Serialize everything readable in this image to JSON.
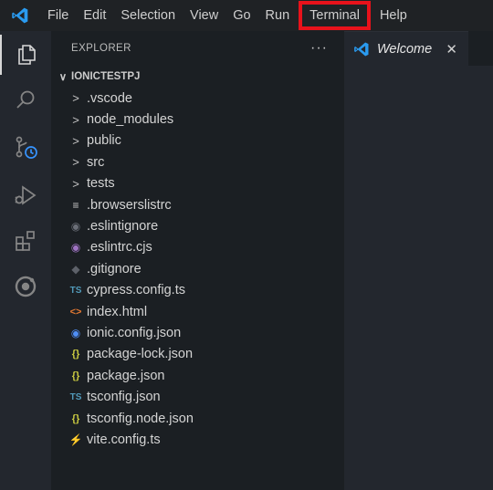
{
  "menubar": {
    "items": [
      "File",
      "Edit",
      "Selection",
      "View",
      "Go",
      "Run",
      "Terminal",
      "Help"
    ],
    "highlighted": "Terminal",
    "highlight_color": "#e8121b",
    "logo_icon": "vscode-logo-icon"
  },
  "activitybar": {
    "items": [
      {
        "icon": "files-icon",
        "active": true
      },
      {
        "icon": "search-icon",
        "active": false
      },
      {
        "icon": "source-control-icon",
        "active": false
      },
      {
        "icon": "run-debug-icon",
        "active": false
      },
      {
        "icon": "extensions-icon",
        "active": false
      },
      {
        "icon": "ionic-icon",
        "active": false
      }
    ]
  },
  "explorer": {
    "title": "EXPLORER",
    "more": "···",
    "folder_chevron": "∨",
    "folder": "IONICTESTPJ",
    "entries": [
      {
        "name": ".vscode",
        "type": "folder",
        "icon": "chevron-right-icon",
        "glyph": ">",
        "color": "#c5c5c5"
      },
      {
        "name": "node_modules",
        "type": "folder",
        "icon": "chevron-right-icon",
        "glyph": ">",
        "color": "#c5c5c5"
      },
      {
        "name": "public",
        "type": "folder",
        "icon": "chevron-right-icon",
        "glyph": ">",
        "color": "#c5c5c5"
      },
      {
        "name": "src",
        "type": "folder",
        "icon": "chevron-right-icon",
        "glyph": ">",
        "color": "#c5c5c5"
      },
      {
        "name": "tests",
        "type": "folder",
        "icon": "chevron-right-icon",
        "glyph": ">",
        "color": "#c5c5c5"
      },
      {
        "name": ".browserslistrc",
        "type": "file",
        "icon": "lines-icon",
        "glyph": "≡",
        "color": "#c8c8c8"
      },
      {
        "name": ".eslintignore",
        "type": "file",
        "icon": "eslint-ignore-icon",
        "glyph": "◉",
        "color": "#6b6f78"
      },
      {
        "name": ".eslintrc.cjs",
        "type": "file",
        "icon": "eslint-icon",
        "glyph": "◉",
        "color": "#a074c4"
      },
      {
        "name": ".gitignore",
        "type": "file",
        "icon": "git-icon",
        "glyph": "◆",
        "color": "#5d6169"
      },
      {
        "name": "cypress.config.ts",
        "type": "file",
        "icon": "typescript-icon",
        "glyph": "TS",
        "color": "#519aba"
      },
      {
        "name": "index.html",
        "type": "file",
        "icon": "html-icon",
        "glyph": "<>",
        "color": "#e37933"
      },
      {
        "name": "ionic.config.json",
        "type": "file",
        "icon": "ionic-file-icon",
        "glyph": "◉",
        "color": "#4f8ff7"
      },
      {
        "name": "package-lock.json",
        "type": "file",
        "icon": "json-icon",
        "glyph": "{}",
        "color": "#cbcb41"
      },
      {
        "name": "package.json",
        "type": "file",
        "icon": "json-icon",
        "glyph": "{}",
        "color": "#cbcb41"
      },
      {
        "name": "tsconfig.json",
        "type": "file",
        "icon": "tsconfig-icon",
        "glyph": "TS",
        "color": "#519aba"
      },
      {
        "name": "tsconfig.node.json",
        "type": "file",
        "icon": "json-icon",
        "glyph": "{}",
        "color": "#cbcb41"
      },
      {
        "name": "vite.config.ts",
        "type": "file",
        "icon": "vite-icon",
        "glyph": "⚡",
        "color": "#ffc61a"
      }
    ]
  },
  "editor": {
    "tab_label": "Welcome",
    "tab_close": "✕",
    "tab_icon": "vscode-logo-icon"
  }
}
